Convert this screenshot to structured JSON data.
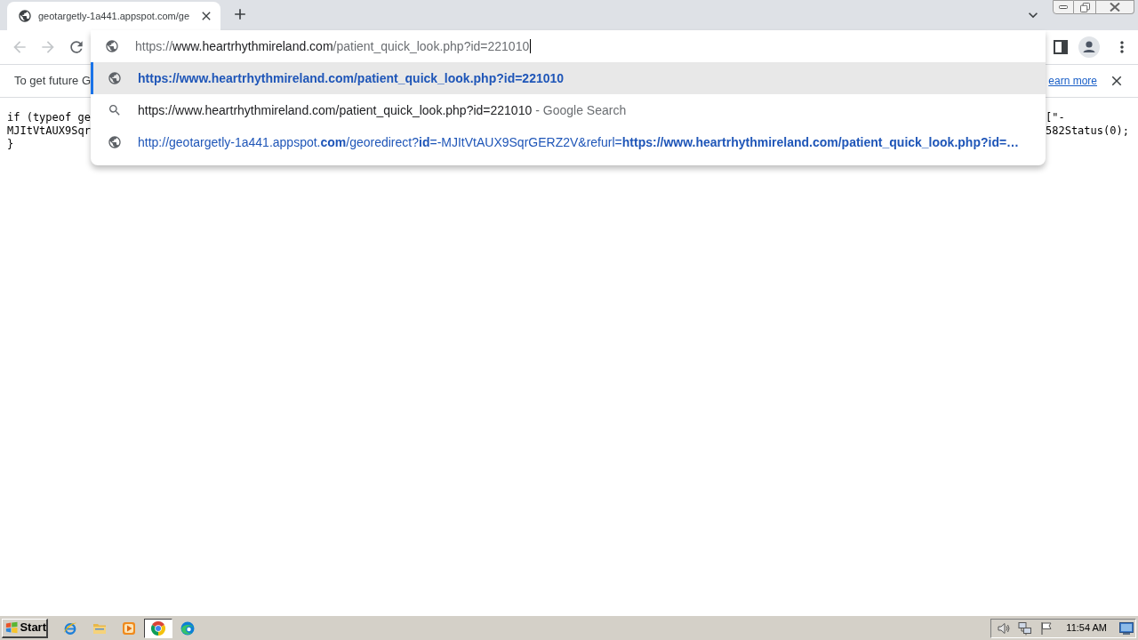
{
  "tabs": [
    {
      "title": "geotargetly-1a441.appspot.com/ge",
      "selected": true
    }
  ],
  "toolbar": {
    "nav": [
      {
        "kind": "back",
        "disabled": true
      },
      {
        "kind": "forward",
        "disabled": true
      },
      {
        "kind": "reload",
        "disabled": false
      }
    ]
  },
  "omnibox": {
    "input": [
      {
        "kind": "scheme",
        "text": "https://"
      },
      {
        "kind": "host",
        "text": "www.heartrhythmireland.com"
      },
      {
        "kind": "path",
        "text": "/patient_quick_look.php?id=221010"
      }
    ],
    "suggestions": [
      {
        "kind": "typed",
        "text": "https://www.heartrhythmireland.com/patient_quick_look.php?id=221010",
        "selected": true
      },
      {
        "kind": "search",
        "text": "https://www.heartrhythmireland.com/patient_quick_look.php?id=221010",
        "description": "- Google Search",
        "selected": false
      },
      {
        "kind": "history",
        "text": "http://geotargetly-1a441.appspot.**com**/georedirect?**id**=-MJItVtAUX9SqrGERZ2V&refurl=**https://www.heartrhythmireland.com/patient_quick_look.php?id=…**",
        "selected": false
      }
    ]
  },
  "infobar": {
    "message": "To get future G",
    "link": "earn more"
  },
  "page": {
    "code_left": [
      "if (typeof ge",
      "MJItVtAUX9Sqr",
      "}"
    ],
    "code_right": [
      "[\"-",
      "582Status(0);"
    ]
  },
  "taskbar": {
    "start": "Start",
    "apps": [
      {
        "kind": "ie",
        "selected": false
      },
      {
        "kind": "explorer",
        "selected": false
      },
      {
        "kind": "media",
        "selected": false
      },
      {
        "kind": "chrome",
        "selected": true
      },
      {
        "kind": "edge",
        "selected": false
      }
    ],
    "clock": "11:54 AM"
  }
}
